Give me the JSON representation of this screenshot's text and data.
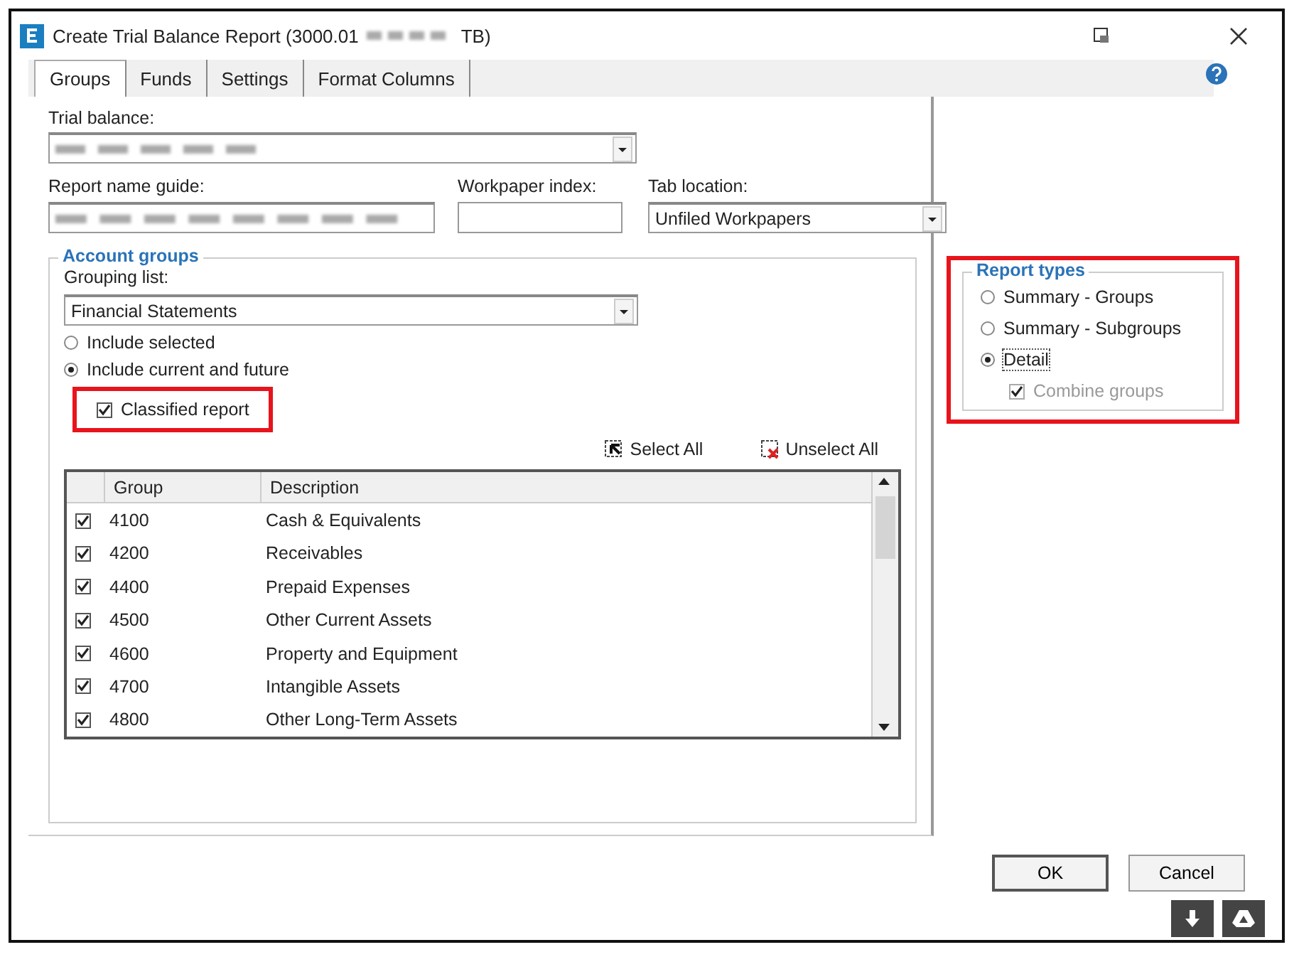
{
  "window": {
    "title_prefix": "Create Trial Balance Report (3000.01",
    "title_suffix": "TB)"
  },
  "tabs": [
    {
      "label": "Groups",
      "selected": true
    },
    {
      "label": "Funds",
      "selected": false
    },
    {
      "label": "Settings",
      "selected": false
    },
    {
      "label": "Format Columns",
      "selected": false
    }
  ],
  "trial_balance": {
    "label": "Trial balance:"
  },
  "report_name_guide": {
    "label": "Report name guide:"
  },
  "workpaper_index": {
    "label": "Workpaper index:"
  },
  "tab_location": {
    "label": "Tab location:",
    "value": "Unfiled Workpapers"
  },
  "account_groups": {
    "title": "Account groups",
    "grouping_label": "Grouping list:",
    "grouping_value": "Financial Statements",
    "scope": [
      {
        "label": "Include selected",
        "selected": false
      },
      {
        "label": "Include current and future",
        "selected": true
      }
    ],
    "classified_report": {
      "label": "Classified report",
      "checked": true
    },
    "actions": [
      {
        "label": "Select All",
        "kind": "select"
      },
      {
        "label": "Unselect All",
        "kind": "unselect"
      }
    ],
    "table": {
      "columns": [
        "Group",
        "Description"
      ],
      "rows": [
        {
          "checked": true,
          "group": "4100",
          "description": "Cash & Equivalents"
        },
        {
          "checked": true,
          "group": "4200",
          "description": "Receivables"
        },
        {
          "checked": true,
          "group": "4400",
          "description": "Prepaid Expenses"
        },
        {
          "checked": true,
          "group": "4500",
          "description": "Other Current Assets"
        },
        {
          "checked": true,
          "group": "4600",
          "description": "Property and Equipment"
        },
        {
          "checked": true,
          "group": "4700",
          "description": "Intangible Assets"
        },
        {
          "checked": true,
          "group": "4800",
          "description": "Other Long-Term Assets"
        }
      ]
    }
  },
  "report_types": {
    "title": "Report types",
    "options": [
      {
        "label": "Summary - Groups",
        "selected": false
      },
      {
        "label": "Summary - Subgroups",
        "selected": false
      },
      {
        "label": "Detail",
        "selected": true
      }
    ],
    "combine_groups": {
      "label": "Combine groups",
      "checked": true,
      "disabled": true
    }
  },
  "buttons": [
    "OK",
    "Cancel"
  ]
}
